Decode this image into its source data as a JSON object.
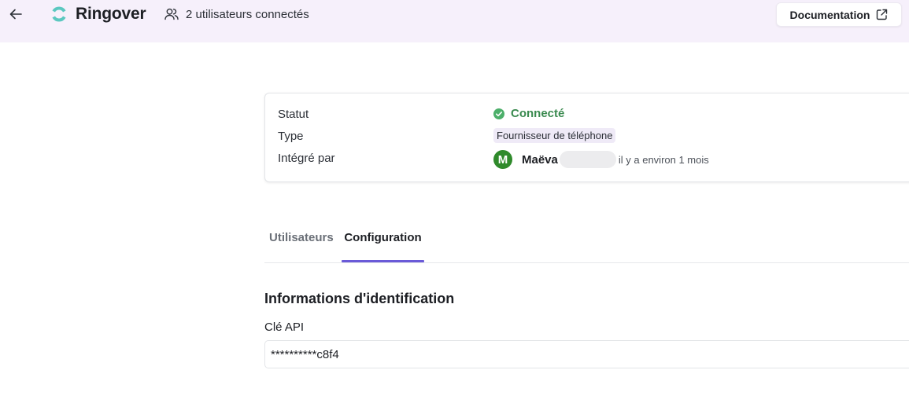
{
  "header": {
    "brand_title": "Ringover",
    "users_connected": "2 utilisateurs connectés",
    "documentation_label": "Documentation",
    "brand_color": "#5bc8c0"
  },
  "info": {
    "status_label": "Statut",
    "status_value": "Connecté",
    "status_color": "#4caf6a",
    "type_label": "Type",
    "type_value": "Fournisseur de téléphone",
    "integrated_label": "Intégré par",
    "avatar_initial": "M",
    "user_name": "Maëva",
    "time_ago": "il y a environ 1 mois"
  },
  "tabs": [
    {
      "label": "Utilisateurs",
      "active": false
    },
    {
      "label": "Configuration",
      "active": true
    }
  ],
  "config": {
    "section_title": "Informations d'identification",
    "api_key_label": "Clé API",
    "api_key_value": "**********c8f4"
  },
  "colors": {
    "accent": "#6a5ad8",
    "topbar_bg": "#f6f0fb"
  }
}
